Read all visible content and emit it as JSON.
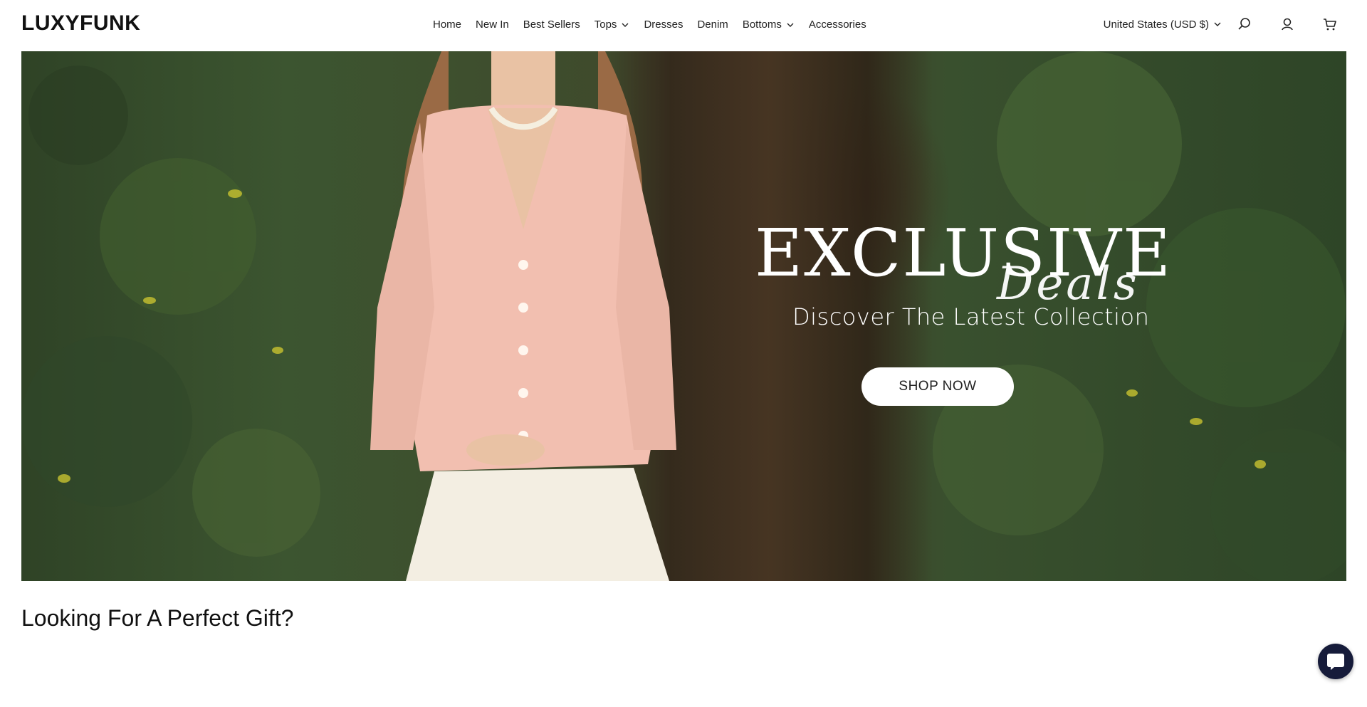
{
  "header": {
    "logo": "LUXYFUNK",
    "nav": [
      {
        "label": "Home",
        "dropdown": false
      },
      {
        "label": "New In",
        "dropdown": false
      },
      {
        "label": "Best Sellers",
        "dropdown": false
      },
      {
        "label": "Tops",
        "dropdown": true
      },
      {
        "label": "Dresses",
        "dropdown": false
      },
      {
        "label": "Denim",
        "dropdown": false
      },
      {
        "label": "Bottoms",
        "dropdown": true
      },
      {
        "label": "Accessories",
        "dropdown": false
      }
    ],
    "currency": "United States (USD $)",
    "icons": [
      "search-icon",
      "account-icon",
      "cart-icon"
    ]
  },
  "hero": {
    "headline": "EXCLUSIVE",
    "script_word": "Deals",
    "subtitle": "Discover The Latest Collection",
    "cta": "SHOP NOW"
  },
  "section": {
    "title": "Looking For A Perfect Gift?"
  },
  "chat": {
    "icon": "chat-icon"
  },
  "colors": {
    "chat_bg": "#161b3a",
    "foliage": "#3c5530"
  }
}
